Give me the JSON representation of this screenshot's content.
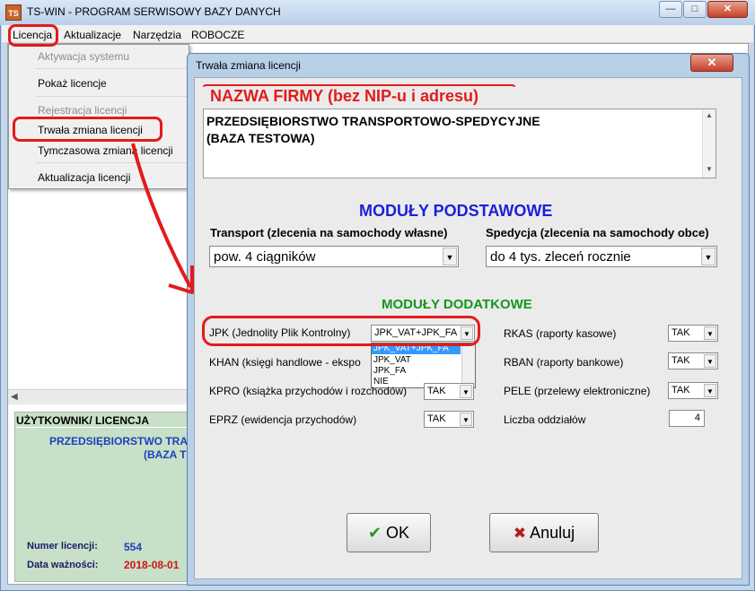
{
  "app": {
    "title": "TS-WIN - PROGRAM SERWISOWY BAZY DANYCH",
    "icon_text": "TS",
    "window_controls": [
      "—",
      "□",
      "✕"
    ]
  },
  "menubar": {
    "items": [
      "Licencja",
      "Aktualizacje",
      "Narzędzia",
      "ROBOCZE"
    ]
  },
  "license_menu": {
    "items": [
      {
        "label": "Aktywacja systemu",
        "enabled": false
      },
      {
        "label": "Pokaż licencje",
        "enabled": true
      },
      {
        "label": "Rejestracja licencji",
        "enabled": false
      },
      {
        "label": "Trwała zmiana licencji",
        "enabled": true
      },
      {
        "label": "Tymczasowa zmiana licencji",
        "enabled": true
      },
      {
        "label": "Aktualizacja licencji",
        "enabled": true
      }
    ]
  },
  "user_panel": {
    "header": "UŻYTKOWNIK/ LICENCJA",
    "company_line1": "PRZEDSIĘBIORSTWO TRA",
    "company_line2": "(BAZA T",
    "license_number_label": "Numer licencji:",
    "license_number": "554",
    "valid_until_label": "Data ważności:",
    "valid_until": "2018-08-01"
  },
  "dialog": {
    "title": "Trwała zmiana licencji",
    "close_glyph": "✕",
    "firm_section_title": "NAZWA FIRMY (bez NIP-u i adresu)",
    "firm_line1": "PRZEDSIĘBIORSTWO TRANSPORTOWO-SPEDYCYJNE",
    "firm_line2": "(BAZA TESTOWA)",
    "basic_modules_title": "MODUŁY PODSTAWOWE",
    "transport_label": "Transport (zlecenia na samochody własne)",
    "transport_value": "pow. 4 ciągników",
    "forwarding_label": "Spedycja (zlecenia na samochody obce)",
    "forwarding_value": "do 4 tys. zleceń rocznie",
    "extra_modules_title": "MODUŁY DODATKOWE",
    "jpk_label": "JPK (Jednolity Plik Kontrolny)",
    "jpk_value": "JPK_VAT+JPK_FA",
    "jpk_options": [
      "JPK_VAT+JPK_FA",
      "JPK_VAT",
      "JPK_FA",
      "NIE"
    ],
    "khan_label": "KHAN (księgi handlowe - ekspo",
    "kpro_label": "KPRO (książka przychodów i rozchodów)",
    "kpro_value": "TAK",
    "eprz_label": "EPRZ (ewidencja przychodów)",
    "eprz_value": "TAK",
    "rkas_label": "RKAS (raporty kasowe)",
    "rkas_value": "TAK",
    "rban_label": "RBAN (raporty bankowe)",
    "rban_value": "TAK",
    "pele_label": "PELE (przelewy elektroniczne)",
    "pele_value": "TAK",
    "branches_label": "Liczba oddziałów",
    "branches_value": "4",
    "ok_label": "OK",
    "ok_icon": "✔",
    "cancel_label": "Anuluj",
    "cancel_icon": "✖"
  },
  "colors": {
    "accent_red": "#e31b1b",
    "section_blue": "#1c1fd8",
    "section_green": "#15961d",
    "panel_green": "#c7e0c7"
  }
}
